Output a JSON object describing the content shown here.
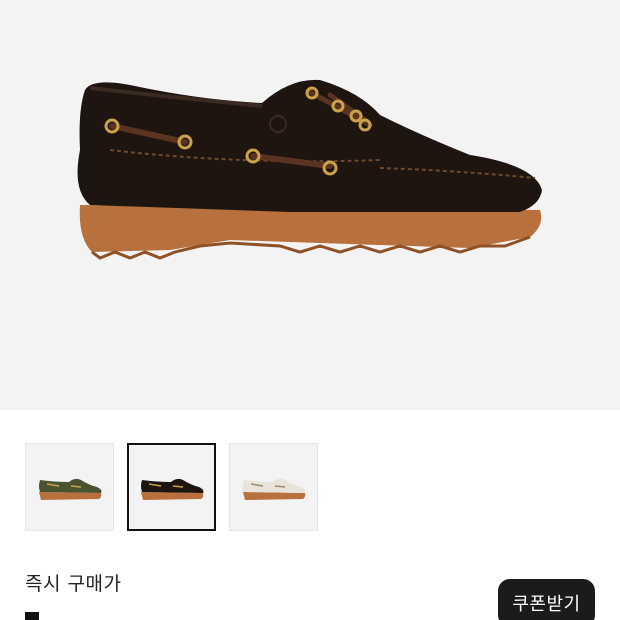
{
  "product": {
    "main_image_icon": "boat-shoe-dark-brown-image",
    "colors": {
      "background": "#f4f3f4",
      "upper": "#1e1410",
      "sole": "#b8703d",
      "lace": "#5a3420",
      "eyelet": "#c9a24a"
    }
  },
  "thumbnails": [
    {
      "icon": "boat-shoe-olive-thumbnail",
      "upper_color": "#4b5230",
      "selected": false
    },
    {
      "icon": "boat-shoe-dark-brown-thumbnail",
      "upper_color": "#1e1410",
      "selected": true
    },
    {
      "icon": "boat-shoe-white-thumbnail",
      "upper_color": "#e8e4dc",
      "selected": false
    }
  ],
  "purchase": {
    "buy_now_label": "즉시 구매가",
    "coupon_button_label": "쿠폰받기"
  }
}
